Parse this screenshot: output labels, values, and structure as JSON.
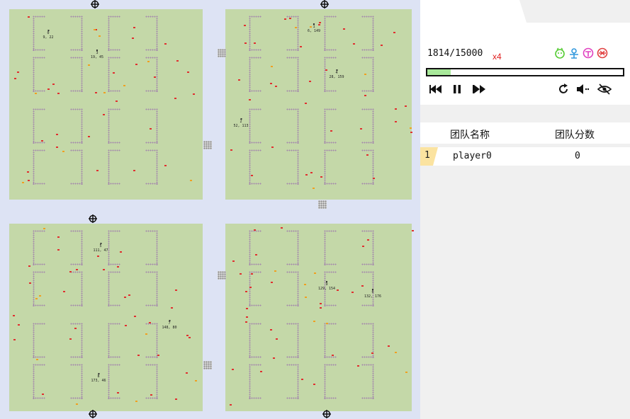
{
  "status": {
    "step": "1814/15000",
    "speed": "x4",
    "progress": 0.12
  },
  "controls": {
    "rewind_icon": "rewind-icon",
    "pause_icon": "pause-icon",
    "forward_icon": "fast-forward-icon",
    "restart_icon": "restart-icon",
    "sound_icon": "sound-icon",
    "view_icon": "eye-icon"
  },
  "characters": [
    {
      "icon": "character-green-icon",
      "color": "#55cc33"
    },
    {
      "icon": "character-blue-icon",
      "color": "#3399dd"
    },
    {
      "icon": "character-pink-icon",
      "color": "#e040c0"
    },
    {
      "icon": "character-red-icon",
      "color": "#e04040"
    }
  ],
  "scoreboard": {
    "headers": [
      "团队名称",
      "团队分数"
    ],
    "rows": [
      {
        "rank": "1",
        "team": "player0",
        "score": "0"
      }
    ]
  },
  "agents": [
    {
      "id": "0",
      "pos": "9, 22"
    },
    {
      "id": "3",
      "pos": "19, 45"
    },
    {
      "id": "1",
      "pos": "6, 149"
    },
    {
      "id": "4",
      "pos": "28, 159"
    },
    {
      "id": "2",
      "pos": "52, 113"
    },
    {
      "id": "5",
      "pos": "111, 47"
    },
    {
      "id": "7",
      "pos": "148, 80"
    },
    {
      "id": "8",
      "pos": "173, 46"
    },
    {
      "id": "9",
      "pos": "129, 154"
    },
    {
      "id": "6",
      "pos": "132, 176"
    }
  ],
  "colors": {
    "map_bg": "#dde3f4",
    "ground": "#c4d8a8",
    "wall": "#a487ac",
    "item_red": "#e03030",
    "item_orange": "#f0a020",
    "rank_highlight": "#fbe3a0"
  }
}
